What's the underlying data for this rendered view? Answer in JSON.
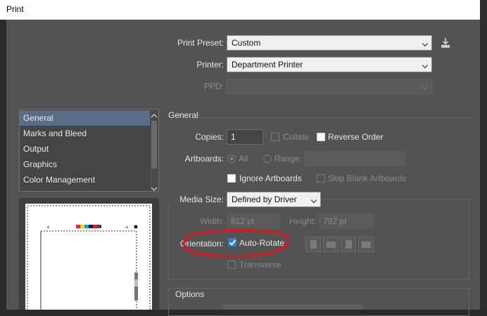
{
  "window": {
    "title": "Print"
  },
  "preset": {
    "label": "Print Preset:",
    "value": "Custom"
  },
  "printer": {
    "label": "Printer:",
    "value": "Department Printer"
  },
  "ppd": {
    "label": "PPD:",
    "value": ""
  },
  "sidebar": {
    "items": [
      {
        "label": "General",
        "selected": true
      },
      {
        "label": "Marks and Bleed"
      },
      {
        "label": "Output"
      },
      {
        "label": "Graphics"
      },
      {
        "label": "Color Management"
      }
    ]
  },
  "general": {
    "heading": "General",
    "copies_label": "Copies:",
    "copies_value": "1",
    "collate_label": "Collate",
    "reverse_order_label": "Reverse Order",
    "artboards_label": "Artboards:",
    "all_label": "All",
    "range_label": "Range:",
    "ignore_artboards_label": "Ignore Artboards",
    "skip_blank_label": "Skip Blank Artboards"
  },
  "media": {
    "size_label": "Media Size:",
    "size_value": "Defined by Driver",
    "width_label": "Width:",
    "width_value": "612 pt",
    "height_label": "Height:",
    "height_value": "792 pt",
    "orientation_label": "Orientation:",
    "auto_rotate_label": "Auto-Rotate",
    "auto_rotate_checked": true,
    "transverse_label": "Transverse"
  },
  "options": {
    "heading": "Options"
  },
  "icons": {
    "save_preset": "save-preset-icon",
    "orientation": [
      "portrait",
      "landscape",
      "portrait-flipped",
      "landscape-flipped"
    ]
  },
  "annotation": {
    "color": "#e0141e"
  },
  "colors": {
    "dialog_bg": "#535353",
    "list_selected": "#5a6d86",
    "checkbox_checked": "#2f7fd2"
  }
}
